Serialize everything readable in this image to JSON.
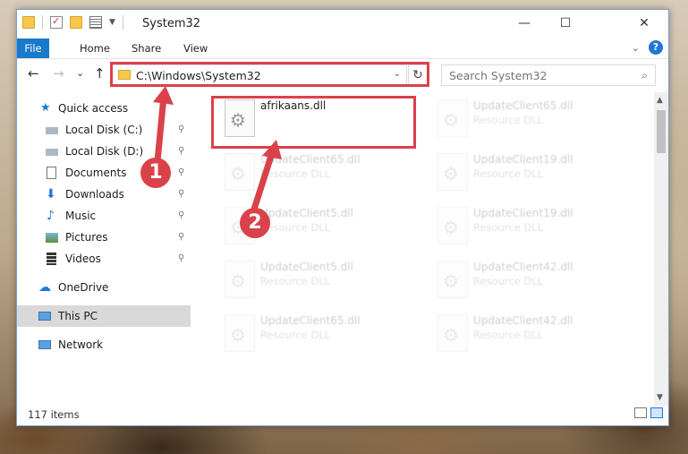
{
  "window": {
    "title": "System32",
    "controls": {
      "minimize": "—",
      "maximize": "☐",
      "close": "✕"
    }
  },
  "ribbon": {
    "tabs": [
      "File",
      "Home",
      "Share",
      "View"
    ],
    "expand_icon": "chevron-down-icon",
    "help_label": "?"
  },
  "nav": {
    "back": "←",
    "forward": "→",
    "recent": "⌄",
    "up": "↑",
    "address_path": "C:\\Windows\\System32",
    "refresh": "↻",
    "search_placeholder": "Search System32",
    "search_icon": "⌕"
  },
  "sidebar": {
    "items": [
      {
        "label": "Quick access",
        "icon": "star-icon",
        "pinned": false
      },
      {
        "label": "Local Disk (C:)",
        "icon": "drive-icon",
        "pinned": true
      },
      {
        "label": "Local Disk (D:)",
        "icon": "drive-icon",
        "pinned": true
      },
      {
        "label": "Documents",
        "icon": "document-icon",
        "pinned": true
      },
      {
        "label": "Downloads",
        "icon": "download-icon",
        "pinned": true
      },
      {
        "label": "Music",
        "icon": "music-icon",
        "pinned": true
      },
      {
        "label": "Pictures",
        "icon": "pictures-icon",
        "pinned": true
      },
      {
        "label": "Videos",
        "icon": "video-icon",
        "pinned": true
      },
      {
        "label": "OneDrive",
        "icon": "cloud-icon",
        "pinned": false
      },
      {
        "label": "This PC",
        "icon": "computer-icon",
        "pinned": false,
        "selected": true
      },
      {
        "label": "Network",
        "icon": "network-icon",
        "pinned": false
      }
    ],
    "pin_glyph": "📌"
  },
  "files": {
    "highlighted": {
      "name": "afrikaans.dll",
      "type": ""
    },
    "faded": [
      {
        "name": "UpdateClient65.dll",
        "type": "Resource DLL"
      },
      {
        "name": "UpdateClient65.dll",
        "type": "Resource DLL"
      },
      {
        "name": "UpdateClient19.dll",
        "type": "Resource DLL"
      },
      {
        "name": "UpdateClient5.dll",
        "type": "Resource DLL"
      },
      {
        "name": "UpdateClient19.dll",
        "type": "Resource DLL"
      },
      {
        "name": "UpdateClient5.dll",
        "type": "Resource DLL"
      },
      {
        "name": "UpdateClient42.dll",
        "type": "Resource DLL"
      },
      {
        "name": "UpdateClient65.dll",
        "type": "Resource DLL"
      },
      {
        "name": "UpdateClient42.dll",
        "type": "Resource DLL"
      }
    ]
  },
  "status": {
    "item_count": "117 items"
  },
  "callouts": {
    "one": "1",
    "two": "2"
  },
  "colors": {
    "accent": "#1979ca",
    "callout": "#d9424a",
    "folder": "#f5c84c"
  }
}
